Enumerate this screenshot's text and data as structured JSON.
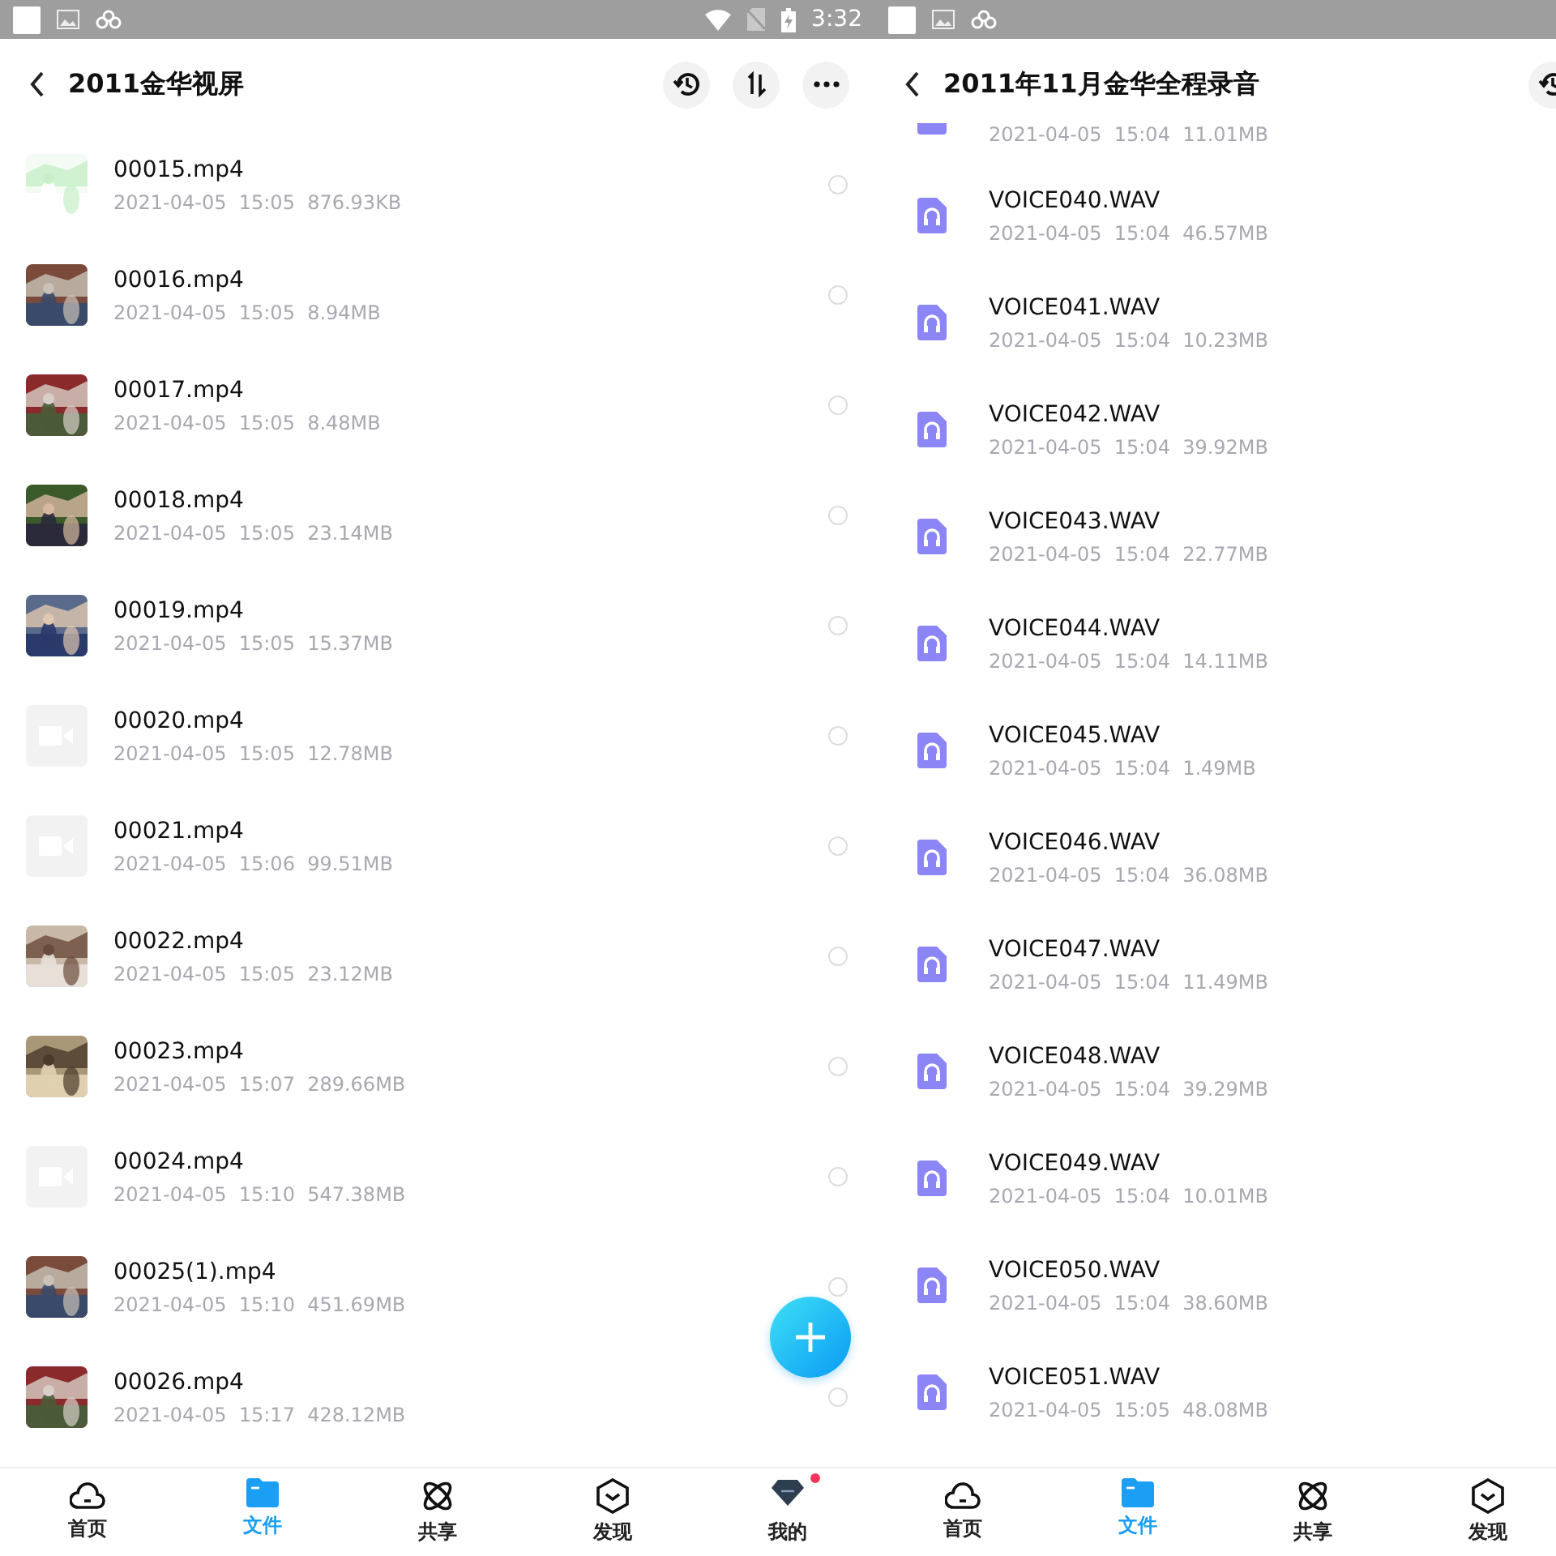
{
  "panels": [
    {
      "status_bar": {
        "time": "3:32",
        "indicators": [
          {
            "kind": "wifi"
          },
          {
            "kind": "no-sim"
          },
          {
            "kind": "battery"
          }
        ]
      },
      "header": {
        "title": "2011金华视屏",
        "actions": [
          {
            "kind": "history"
          },
          {
            "kind": "sort"
          },
          {
            "kind": "more"
          }
        ]
      },
      "files": [
        {
          "name": "00015.mp4",
          "meta": "2021-04-05  15:05  876.93KB",
          "selected": false
        },
        {
          "name": "00016.mp4",
          "meta": "2021-04-05  15:05  8.94MB",
          "selected": false
        },
        {
          "name": "00017.mp4",
          "meta": "2021-04-05  15:05  8.48MB",
          "selected": false
        },
        {
          "name": "00018.mp4",
          "meta": "2021-04-05  15:05  23.14MB",
          "selected": false
        },
        {
          "name": "00019.mp4",
          "meta": "2021-04-05  15:05  15.37MB",
          "selected": false
        },
        {
          "kind": "video",
          "name": "00020.mp4",
          "meta": "2021-04-05  15:05  12.78MB",
          "selected": false
        },
        {
          "kind": "video",
          "name": "00021.mp4",
          "meta": "2021-04-05  15:06  99.51MB",
          "selected": false
        },
        {
          "name": "00022.mp4",
          "meta": "2021-04-05  15:05  23.12MB",
          "selected": false
        },
        {
          "name": "00023.mp4",
          "meta": "2021-04-05  15:07  289.66MB",
          "selected": false
        },
        {
          "kind": "video",
          "name": "00024.mp4",
          "meta": "2021-04-05  15:10  547.38MB",
          "selected": false
        },
        {
          "name": "00025(1).mp4",
          "meta": "2021-04-05  15:10  451.69MB",
          "selected": false
        },
        {
          "name": "00026.mp4",
          "meta": "2021-04-05  15:17  428.12MB",
          "selected": false
        }
      ],
      "fab": {
        "kind": "add"
      },
      "nav": [
        {
          "kind": "home",
          "label": "首页",
          "selected": false,
          "badge": false
        },
        {
          "kind": "files",
          "label": "文件",
          "selected": true,
          "badge": false
        },
        {
          "kind": "share",
          "label": "共享",
          "selected": false,
          "badge": false
        },
        {
          "kind": "discover",
          "label": "发现",
          "selected": false,
          "badge": false
        },
        {
          "kind": "mine",
          "label": "我的",
          "selected": false,
          "badge": true
        }
      ]
    },
    {
      "header": {
        "title": "2011年11月金华全程录音",
        "actions": [
          {
            "kind": "history"
          }
        ]
      },
      "files": [
        {
          "kind": "audio-partial",
          "meta": "2021-04-05  15:04  11.01MB"
        },
        {
          "kind": "audio",
          "name": "VOICE040.WAV",
          "meta": "2021-04-05  15:04  46.57MB"
        },
        {
          "kind": "audio",
          "name": "VOICE041.WAV",
          "meta": "2021-04-05  15:04  10.23MB"
        },
        {
          "kind": "audio",
          "name": "VOICE042.WAV",
          "meta": "2021-04-05  15:04  39.92MB"
        },
        {
          "kind": "audio",
          "name": "VOICE043.WAV",
          "meta": "2021-04-05  15:04  22.77MB"
        },
        {
          "kind": "audio",
          "name": "VOICE044.WAV",
          "meta": "2021-04-05  15:04  14.11MB"
        },
        {
          "kind": "audio",
          "name": "VOICE045.WAV",
          "meta": "2021-04-05  15:04  1.49MB"
        },
        {
          "kind": "audio",
          "name": "VOICE046.WAV",
          "meta": "2021-04-05  15:04  36.08MB"
        },
        {
          "kind": "audio",
          "name": "VOICE047.WAV",
          "meta": "2021-04-05  15:04  11.49MB"
        },
        {
          "kind": "audio",
          "name": "VOICE048.WAV",
          "meta": "2021-04-05  15:04  39.29MB"
        },
        {
          "kind": "audio",
          "name": "VOICE049.WAV",
          "meta": "2021-04-05  15:04  10.01MB"
        },
        {
          "kind": "audio",
          "name": "VOICE050.WAV",
          "meta": "2021-04-05  15:04  38.60MB"
        },
        {
          "kind": "audio",
          "name": "VOICE051.WAV",
          "meta": "2021-04-05  15:05  48.08MB"
        }
      ],
      "nav": [
        {
          "kind": "home",
          "label": "首页",
          "selected": false,
          "badge": false
        },
        {
          "kind": "files",
          "label": "文件",
          "selected": true,
          "badge": false
        },
        {
          "kind": "share",
          "label": "共享",
          "selected": false,
          "badge": false
        },
        {
          "kind": "discover",
          "label": "发现",
          "selected": false,
          "badge": false
        }
      ]
    }
  ]
}
